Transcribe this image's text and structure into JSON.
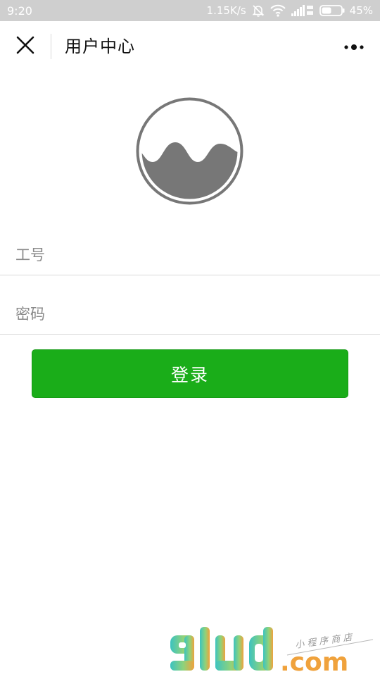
{
  "status_bar": {
    "time": "9:20",
    "network_speed": "1.15K/s",
    "battery": "45%",
    "icons": [
      "mute-bell-icon",
      "wifi-icon",
      "signal-4g-icon",
      "battery-icon"
    ]
  },
  "nav": {
    "title": "用户中心",
    "close_icon": "close-icon",
    "more_icon": "more-dots-icon"
  },
  "logo": {
    "icon": "wave-circle-logo"
  },
  "form": {
    "username_placeholder": "工号",
    "password_placeholder": "密码",
    "username_value": "",
    "password_value": ""
  },
  "login": {
    "label": "登录"
  },
  "colors": {
    "primary_green": "#1aad19",
    "status_bar_bg": "#cfcfcf",
    "logo_gray": "#777777",
    "divider": "#d9d9d9"
  },
  "watermark": {
    "brand": "91ud",
    "suffix": ".com",
    "tagline": "小程序商店"
  }
}
